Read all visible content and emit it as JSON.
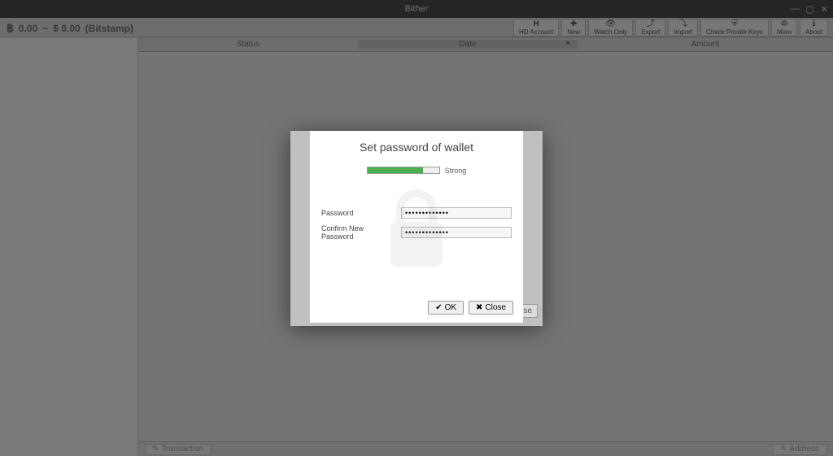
{
  "window": {
    "title": "Bither"
  },
  "balance": {
    "btc": "0.00",
    "separator": "~",
    "fiat": "$ 0.00",
    "exchange": "(Bitstamp)"
  },
  "toolbar": {
    "hd_account": "HD Account",
    "new": "New",
    "watch_only": "Watch Only",
    "export": "Export",
    "import": "Import",
    "check_keys": "Check Private Keys",
    "more": "More",
    "about": "About"
  },
  "table": {
    "status": "Status",
    "date": "Date",
    "amount": "Amount"
  },
  "bottombar": {
    "transaction": "Transaction",
    "address": "Address"
  },
  "modal": {
    "title": "Set password of wallet",
    "strength": {
      "percent": 78,
      "label": "Strong"
    },
    "labels": {
      "password": "Password",
      "confirm": "Confirm New Password"
    },
    "fields": {
      "password": "•••••••••••••",
      "confirm": "•••••••••••••"
    },
    "actions": {
      "ok": "OK",
      "close": "Close"
    },
    "behind_button": "se"
  }
}
